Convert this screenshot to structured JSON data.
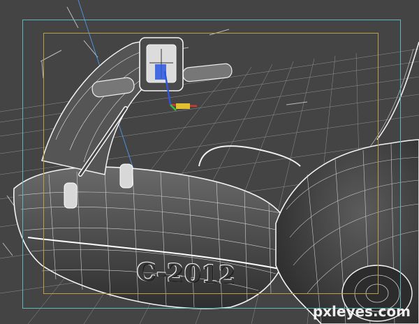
{
  "viewport": {
    "content": "3D wireframe render of a motorcycle front (handlebar with gauge, gas tank and front fender) in a modeling application viewport"
  },
  "model": {
    "label": "C-2012"
  },
  "watermark": {
    "text": "pxleyes.com"
  },
  "colors": {
    "background": "#444444",
    "wire": "#e8e8e8",
    "safe_frame_outer": "#5fb6bf",
    "safe_frame_inner": "#b9a14a",
    "axis_x": "#d43a2a",
    "axis_y": "#3bbf3b",
    "axis_z": "#2b56e0"
  },
  "icons": [
    "transform-gizmo-icon"
  ]
}
